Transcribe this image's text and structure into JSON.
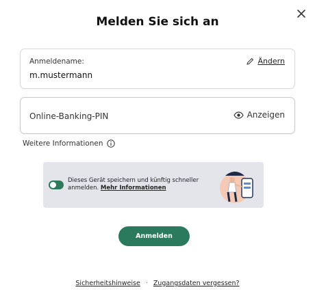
{
  "dialog": {
    "title": "Melden Sie sich an",
    "close_icon": "close-icon"
  },
  "username": {
    "label": "Anmeldename:",
    "value": "m.mustermann",
    "change_label": "Ändern",
    "change_icon": "pencil-icon"
  },
  "pin": {
    "placeholder": "Online-Banking-PIN",
    "show_label": "Anzeigen",
    "show_icon": "eye-icon"
  },
  "info": {
    "label": "Weitere Informationen",
    "icon": "info-icon"
  },
  "remember": {
    "enabled": true,
    "text": "Dieses Gerät speichern und künftig schneller anmelden.",
    "link": "Mehr Informationen",
    "illustration": "person-with-phone-illustration"
  },
  "login_button": "Anmelden",
  "footer": {
    "security_link": "Sicherheitshinweise",
    "separator": "·",
    "forgot_link": "Zugangsdaten vergessen?"
  },
  "colors": {
    "accent": "#2b7a5e",
    "promo_bg": "#e3e5ea"
  }
}
